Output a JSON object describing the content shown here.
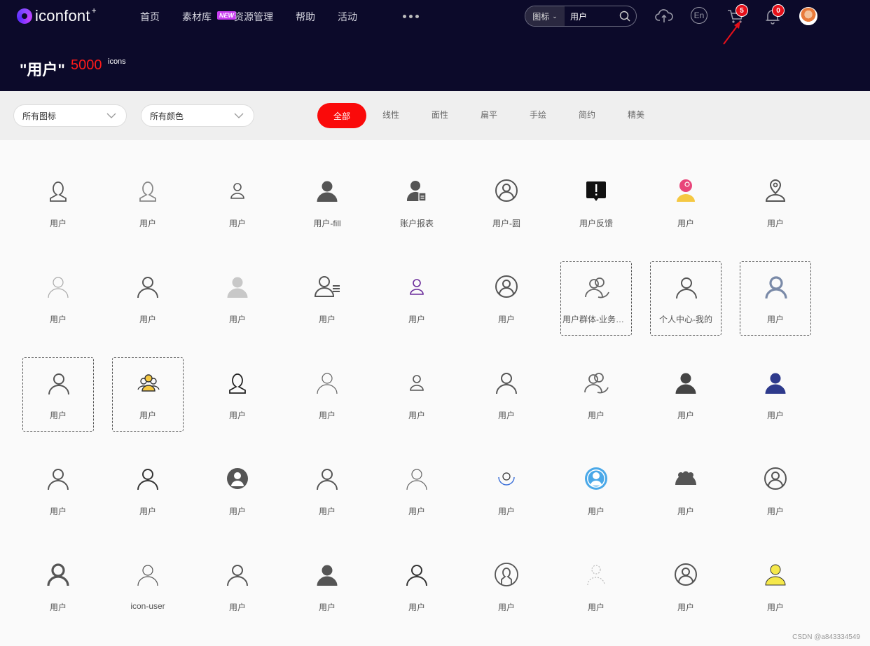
{
  "brand": {
    "name": "iconfont",
    "plus": "+"
  },
  "nav": [
    {
      "label": "首页"
    },
    {
      "label": "素材库",
      "badge": "NEW"
    },
    {
      "label": "资源管理"
    },
    {
      "label": "帮助"
    },
    {
      "label": "活动"
    }
  ],
  "search": {
    "type_label": "图标",
    "value": "用户"
  },
  "toolbar": {
    "lang_label": "En",
    "cart_count": "5",
    "notify_count": "0"
  },
  "result": {
    "query": "\"用户\"",
    "count": "5000",
    "unit": "icons"
  },
  "filters": {
    "icon_type": "所有图标",
    "color": "所有颜色"
  },
  "style_tabs": [
    "全部",
    "线性",
    "面性",
    "扁平",
    "手绘",
    "简约",
    "精美"
  ],
  "icons": [
    [
      "用户",
      "用户",
      "用户",
      "用户-fill",
      "账户报表",
      "用户-圆",
      "用户反馈",
      "用户",
      "用户"
    ],
    [
      "用户",
      "用户",
      "用户",
      "用户",
      "用户",
      "用户",
      "用户群体-业务查询",
      "个人中心-我的",
      "用户"
    ],
    [
      "用户",
      "用户",
      "用户",
      "用户",
      "用户",
      "用户",
      "用户",
      "用户",
      "用户"
    ],
    [
      "用户",
      "用户",
      "用户",
      "用户",
      "用户",
      "用户",
      "用户",
      "用户",
      "用户"
    ],
    [
      "用户",
      "icon-user",
      "用户",
      "用户",
      "用户",
      "用户",
      "用户",
      "用户",
      "用户"
    ]
  ],
  "watermark": "CSDN @a843334549",
  "colors": {
    "header_bg": "#0c0a2a",
    "accent_red": "#fa0a0a",
    "count_red": "#ff1a1a"
  }
}
